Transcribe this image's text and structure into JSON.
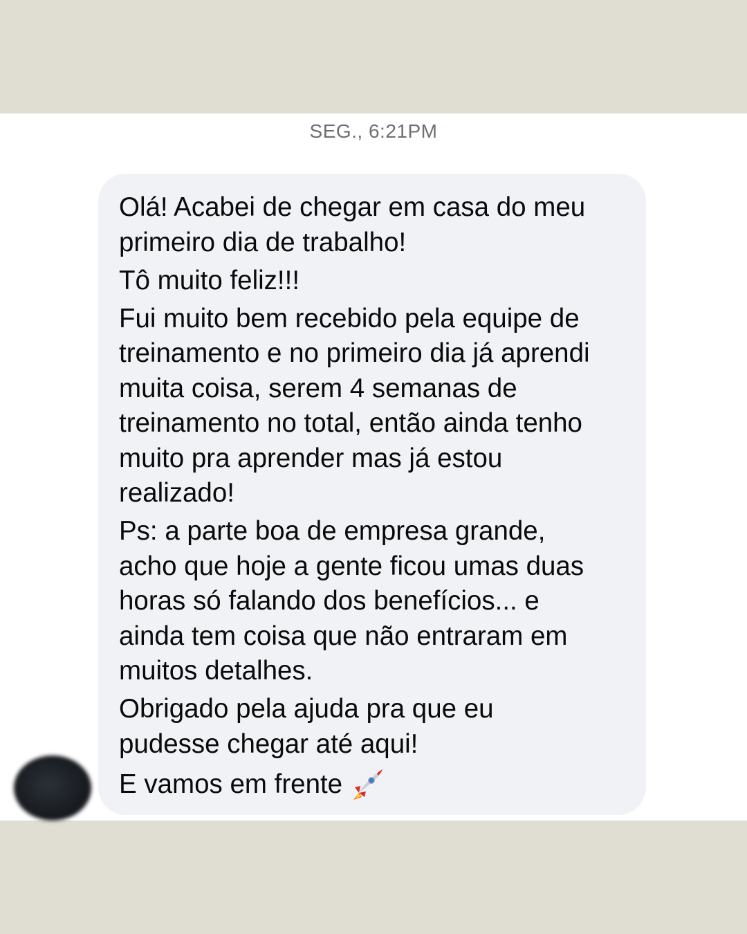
{
  "conversation": {
    "timestamp": "SEG., 6:21PM",
    "message": {
      "paragraphs": [
        [
          "Olá! Acabei de chegar em casa do meu",
          "primeiro dia de trabalho!"
        ],
        [
          "Tô muito feliz!!!"
        ],
        [
          "Fui muito bem recebido pela equipe de",
          "treinamento e no primeiro dia já aprendi",
          "muita coisa, serem 4 semanas de",
          "treinamento no total, então ainda tenho",
          "muito pra aprender mas já estou",
          "realizado!"
        ],
        [
          "Ps: a parte boa de empresa grande,",
          "acho que hoje a gente ficou umas duas",
          "horas só falando dos benefícios... e",
          "ainda tem coisa que não entraram em",
          "muitos detalhes."
        ],
        [
          "Obrigado pela ajuda pra que eu",
          "pudesse chegar até aqui!"
        ]
      ],
      "closing_line": "E vamos em frente",
      "closing_icon": "rocket-icon"
    },
    "sender_avatar": "blurred-avatar",
    "colors": {
      "page_background": "#e0ddd2",
      "chat_background": "#ffffff",
      "bubble_background": "#f1f2f6",
      "text": "#0a0a0a",
      "timestamp": "#6e6e73"
    }
  }
}
